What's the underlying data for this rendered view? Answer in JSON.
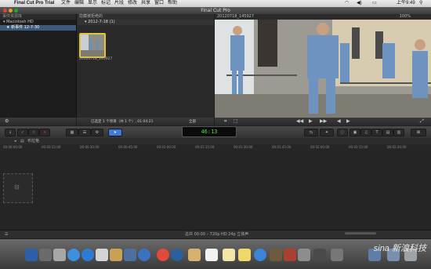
{
  "menubar": {
    "app_name": "Final Cut Pro Trial",
    "items": [
      "文件",
      "编辑",
      "显示",
      "标记",
      "片段",
      "修改",
      "共享",
      "窗口",
      "帮助"
    ],
    "clock": "上午9:49"
  },
  "window": {
    "title": "Final Cut Pro"
  },
  "library": {
    "header": "事件资源库",
    "disk": "Macintosh HD",
    "event": "新事件 12-7-30"
  },
  "browser": {
    "header": "隐藏被拒绝的",
    "event_date": "2012-7-18",
    "event_count": "(1)",
    "clip_name": "20120718_145927",
    "footer": "已选定 1 个项目（共 1 个）, 01:04:21",
    "footer_right": "全部"
  },
  "viewer": {
    "clip_name": "20120718_145927",
    "zoom": "100%"
  },
  "toolbar": {
    "timecode": "46:13"
  },
  "timeline": {
    "project_name": "布拉格",
    "ruler": [
      "00:00:00:00",
      "00:00:15:00",
      "00:00:30:00",
      "00:00:45:00",
      "00:01:00:00",
      "00:01:15:00",
      "00:01:30:00",
      "00:01:45:00",
      "00:02:00:00",
      "00:02:15:00",
      "00:02:30:00"
    ],
    "status": "总共 00:00 – 720p HD 24p 立体声"
  },
  "watermark": "sina 新浪科技",
  "colors": {
    "accent": "#3d7bd9",
    "timecode": "#48e048",
    "record": "#d63b3b"
  }
}
